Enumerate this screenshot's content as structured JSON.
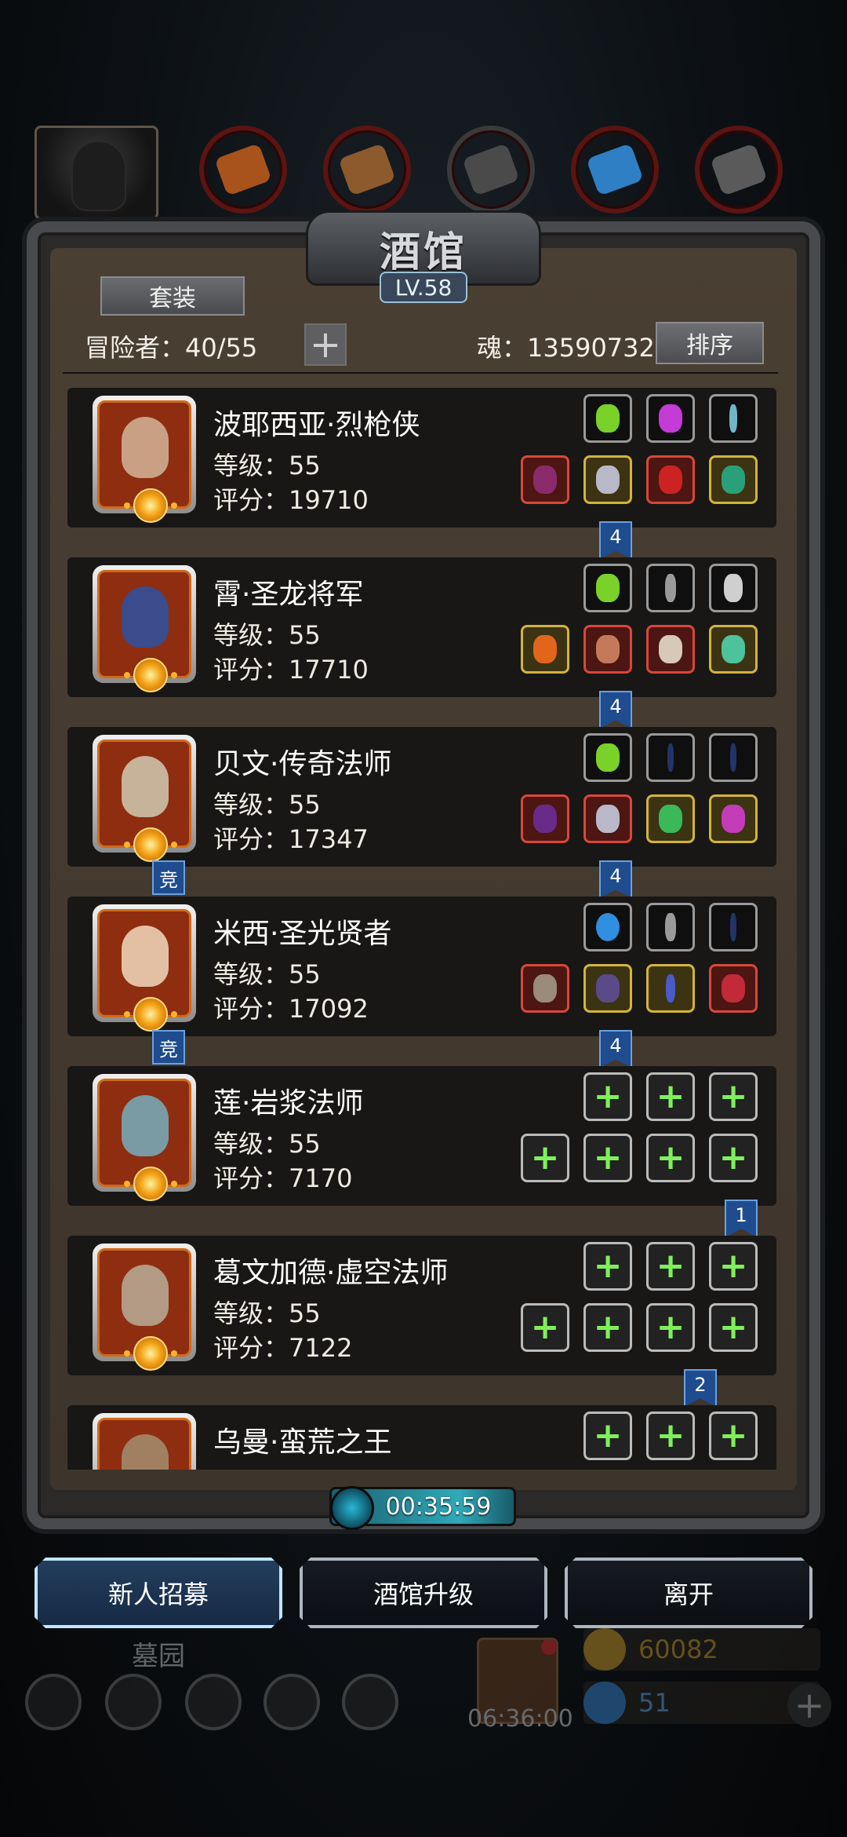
{
  "tavern": {
    "title": "酒馆",
    "level_label": "LV.58",
    "suit_button": "套装",
    "adventurers_label": "冒险者：40/55",
    "soul_label": "魂：13590732",
    "sort_button": "排序",
    "add_symbol": "+"
  },
  "top_tabs": [
    {
      "name": "hero-portrait"
    },
    {
      "name": "tab-armor",
      "color": "#a8521c"
    },
    {
      "name": "tab-wood",
      "color": "#8c5a2c"
    },
    {
      "name": "tab-iron",
      "color": "#4a4a4a"
    },
    {
      "name": "tab-crystal",
      "color": "#2f7fc4"
    },
    {
      "name": "tab-steel",
      "color": "#5a5a5a"
    }
  ],
  "heroes": [
    {
      "name": "波耶西亚·烈枪侠",
      "level": "等级：55",
      "score": "评分：19710",
      "badge": "4"
    },
    {
      "name": "霄·圣龙将军",
      "level": "等级：55",
      "score": "评分：17710",
      "badge": "4"
    },
    {
      "name": "贝文·传奇法师",
      "level": "等级：55",
      "score": "评分：17347",
      "badge": "4",
      "competitive": "竞"
    },
    {
      "name": "米西·圣光贤者",
      "level": "等级：55",
      "score": "评分：17092",
      "badge": "4",
      "competitive": "竞"
    },
    {
      "name": "莲·岩浆法师",
      "level": "等级：55",
      "score": "评分：7170",
      "badge": "1"
    },
    {
      "name": "葛文加德·虚空法师",
      "level": "等级：55",
      "score": "评分：7122",
      "badge": "2"
    },
    {
      "name": "乌曼·蛮荒之王"
    }
  ],
  "timer": "00:35:59",
  "actions": {
    "recruit": "新人招募",
    "upgrade": "酒馆升级",
    "leave": "离开"
  },
  "hud": {
    "graveyard": "墓园",
    "chest_timer": "06:36:00",
    "gold": "60082",
    "gems": "51",
    "plus": "+"
  },
  "colors": {
    "accent_blue": "#1f4c8e",
    "plus_green": "#7ff05a",
    "slot_red": "#d8473a",
    "slot_gold": "#d3b43c"
  }
}
